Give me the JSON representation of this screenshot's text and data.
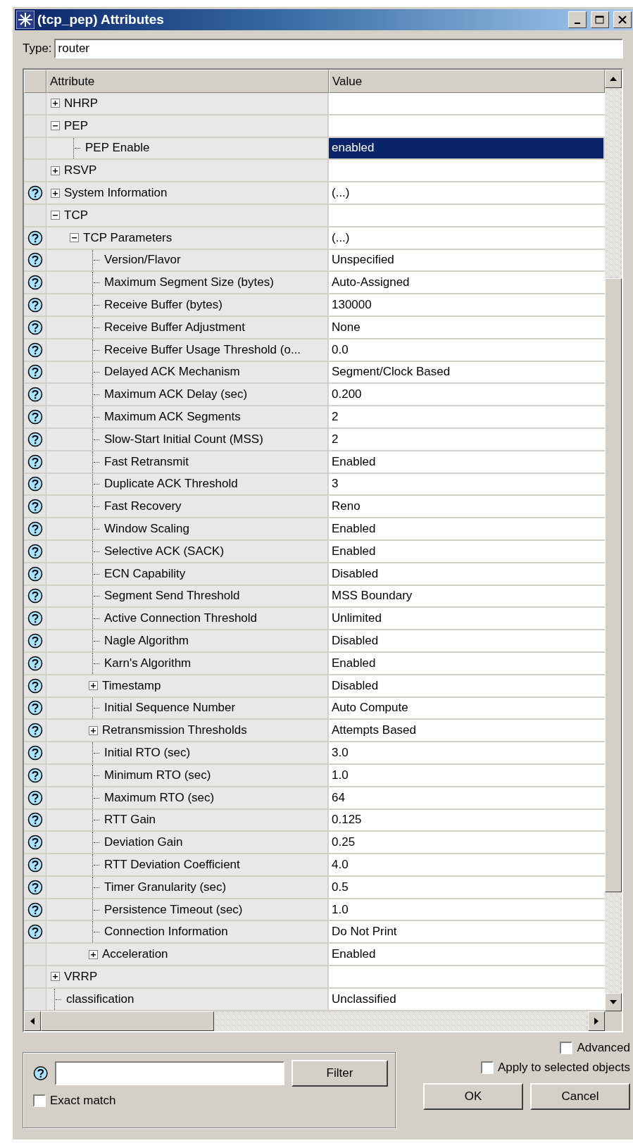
{
  "window": {
    "title": "(tcp_pep) Attributes"
  },
  "type_field": {
    "label": "Type:",
    "value": "router"
  },
  "table": {
    "columns": [
      "Attribute",
      "Value"
    ],
    "rows": [
      {
        "label": "NHRP",
        "help": false,
        "expanded": false
      },
      {
        "label": "PEP",
        "help": false,
        "expanded": true,
        "children": [
          {
            "label": "PEP Enable",
            "value": "enabled",
            "help": false,
            "selected": true
          }
        ]
      },
      {
        "label": "RSVP",
        "help": false,
        "expanded": false
      },
      {
        "label": "System Information",
        "value": "(...)",
        "help": true,
        "expanded": false
      },
      {
        "label": "TCP",
        "help": false,
        "expanded": true,
        "children": [
          {
            "label": "TCP Parameters",
            "value": "(...)",
            "help": true,
            "expanded": true,
            "children": [
              {
                "label": "Version/Flavor",
                "value": "Unspecified",
                "help": true,
                "selected": false
              },
              {
                "label": "Maximum Segment Size (bytes)",
                "value": "Auto-Assigned",
                "help": true,
                "selected": false
              },
              {
                "label": "Receive Buffer (bytes)",
                "value": "130000",
                "help": true,
                "selected": false
              },
              {
                "label": "Receive Buffer Adjustment",
                "value": "None",
                "help": true,
                "selected": false
              },
              {
                "label": "Receive Buffer Usage Threshold (o...",
                "value": "0.0",
                "help": true,
                "selected": false
              },
              {
                "label": "Delayed ACK Mechanism",
                "value": "Segment/Clock Based",
                "help": true,
                "selected": false
              },
              {
                "label": "Maximum ACK Delay (sec)",
                "value": "0.200",
                "help": true,
                "selected": false
              },
              {
                "label": "Maximum ACK Segments",
                "value": "2",
                "help": true,
                "selected": false
              },
              {
                "label": "Slow-Start Initial Count (MSS)",
                "value": "2",
                "help": true,
                "selected": false
              },
              {
                "label": "Fast Retransmit",
                "value": "Enabled",
                "help": true,
                "selected": false
              },
              {
                "label": "Duplicate ACK Threshold",
                "value": "3",
                "help": true,
                "selected": false
              },
              {
                "label": "Fast Recovery",
                "value": "Reno",
                "help": true,
                "selected": false
              },
              {
                "label": "Window Scaling",
                "value": "Enabled",
                "help": true,
                "selected": false
              },
              {
                "label": "Selective ACK (SACK)",
                "value": "Enabled",
                "help": true,
                "selected": false
              },
              {
                "label": "ECN Capability",
                "value": "Disabled",
                "help": true,
                "selected": false
              },
              {
                "label": "Segment Send Threshold",
                "value": "MSS Boundary",
                "help": true,
                "selected": false
              },
              {
                "label": "Active Connection Threshold",
                "value": "Unlimited",
                "help": true,
                "selected": false
              },
              {
                "label": "Nagle Algorithm",
                "value": "Disabled",
                "help": true,
                "selected": false
              },
              {
                "label": "Karn's Algorithm",
                "value": "Enabled",
                "help": true,
                "selected": false
              },
              {
                "label": "Timestamp",
                "value": "Disabled",
                "help": true,
                "expanded": false
              },
              {
                "label": "Initial Sequence Number",
                "value": "Auto Compute",
                "help": true,
                "selected": false
              },
              {
                "label": "Retransmission Thresholds",
                "value": "Attempts Based",
                "help": true,
                "expanded": false
              },
              {
                "label": "Initial RTO (sec)",
                "value": "3.0",
                "help": true,
                "selected": false
              },
              {
                "label": "Minimum RTO (sec)",
                "value": "1.0",
                "help": true,
                "selected": false
              },
              {
                "label": "Maximum RTO (sec)",
                "value": "64",
                "help": true,
                "selected": false
              },
              {
                "label": "RTT Gain",
                "value": "0.125",
                "help": true,
                "selected": false
              },
              {
                "label": "Deviation Gain",
                "value": "0.25",
                "help": true,
                "selected": false
              },
              {
                "label": "RTT Deviation Coefficient",
                "value": "4.0",
                "help": true,
                "selected": false
              },
              {
                "label": "Timer Granularity (sec)",
                "value": "0.5",
                "help": true,
                "selected": false
              },
              {
                "label": "Persistence Timeout (sec)",
                "value": "1.0",
                "help": true,
                "selected": false
              },
              {
                "label": "Connection Information",
                "value": "Do Not Print",
                "help": true,
                "selected": false
              },
              {
                "label": "Acceleration",
                "value": "Enabled",
                "help": false,
                "expanded": false
              }
            ]
          }
        ]
      },
      {
        "label": "VRRP",
        "help": false,
        "expanded": false
      },
      {
        "label": "classification",
        "value": "Unclassified",
        "help": false,
        "selected": false
      }
    ]
  },
  "filter": {
    "button": "Filter",
    "exact_match": {
      "label": "Exact match",
      "checked": false
    }
  },
  "advanced": {
    "label": "Advanced",
    "checked": false
  },
  "apply_to_selected": {
    "label": "Apply to selected objects",
    "checked": false
  },
  "buttons": [
    "OK",
    "Cancel"
  ]
}
